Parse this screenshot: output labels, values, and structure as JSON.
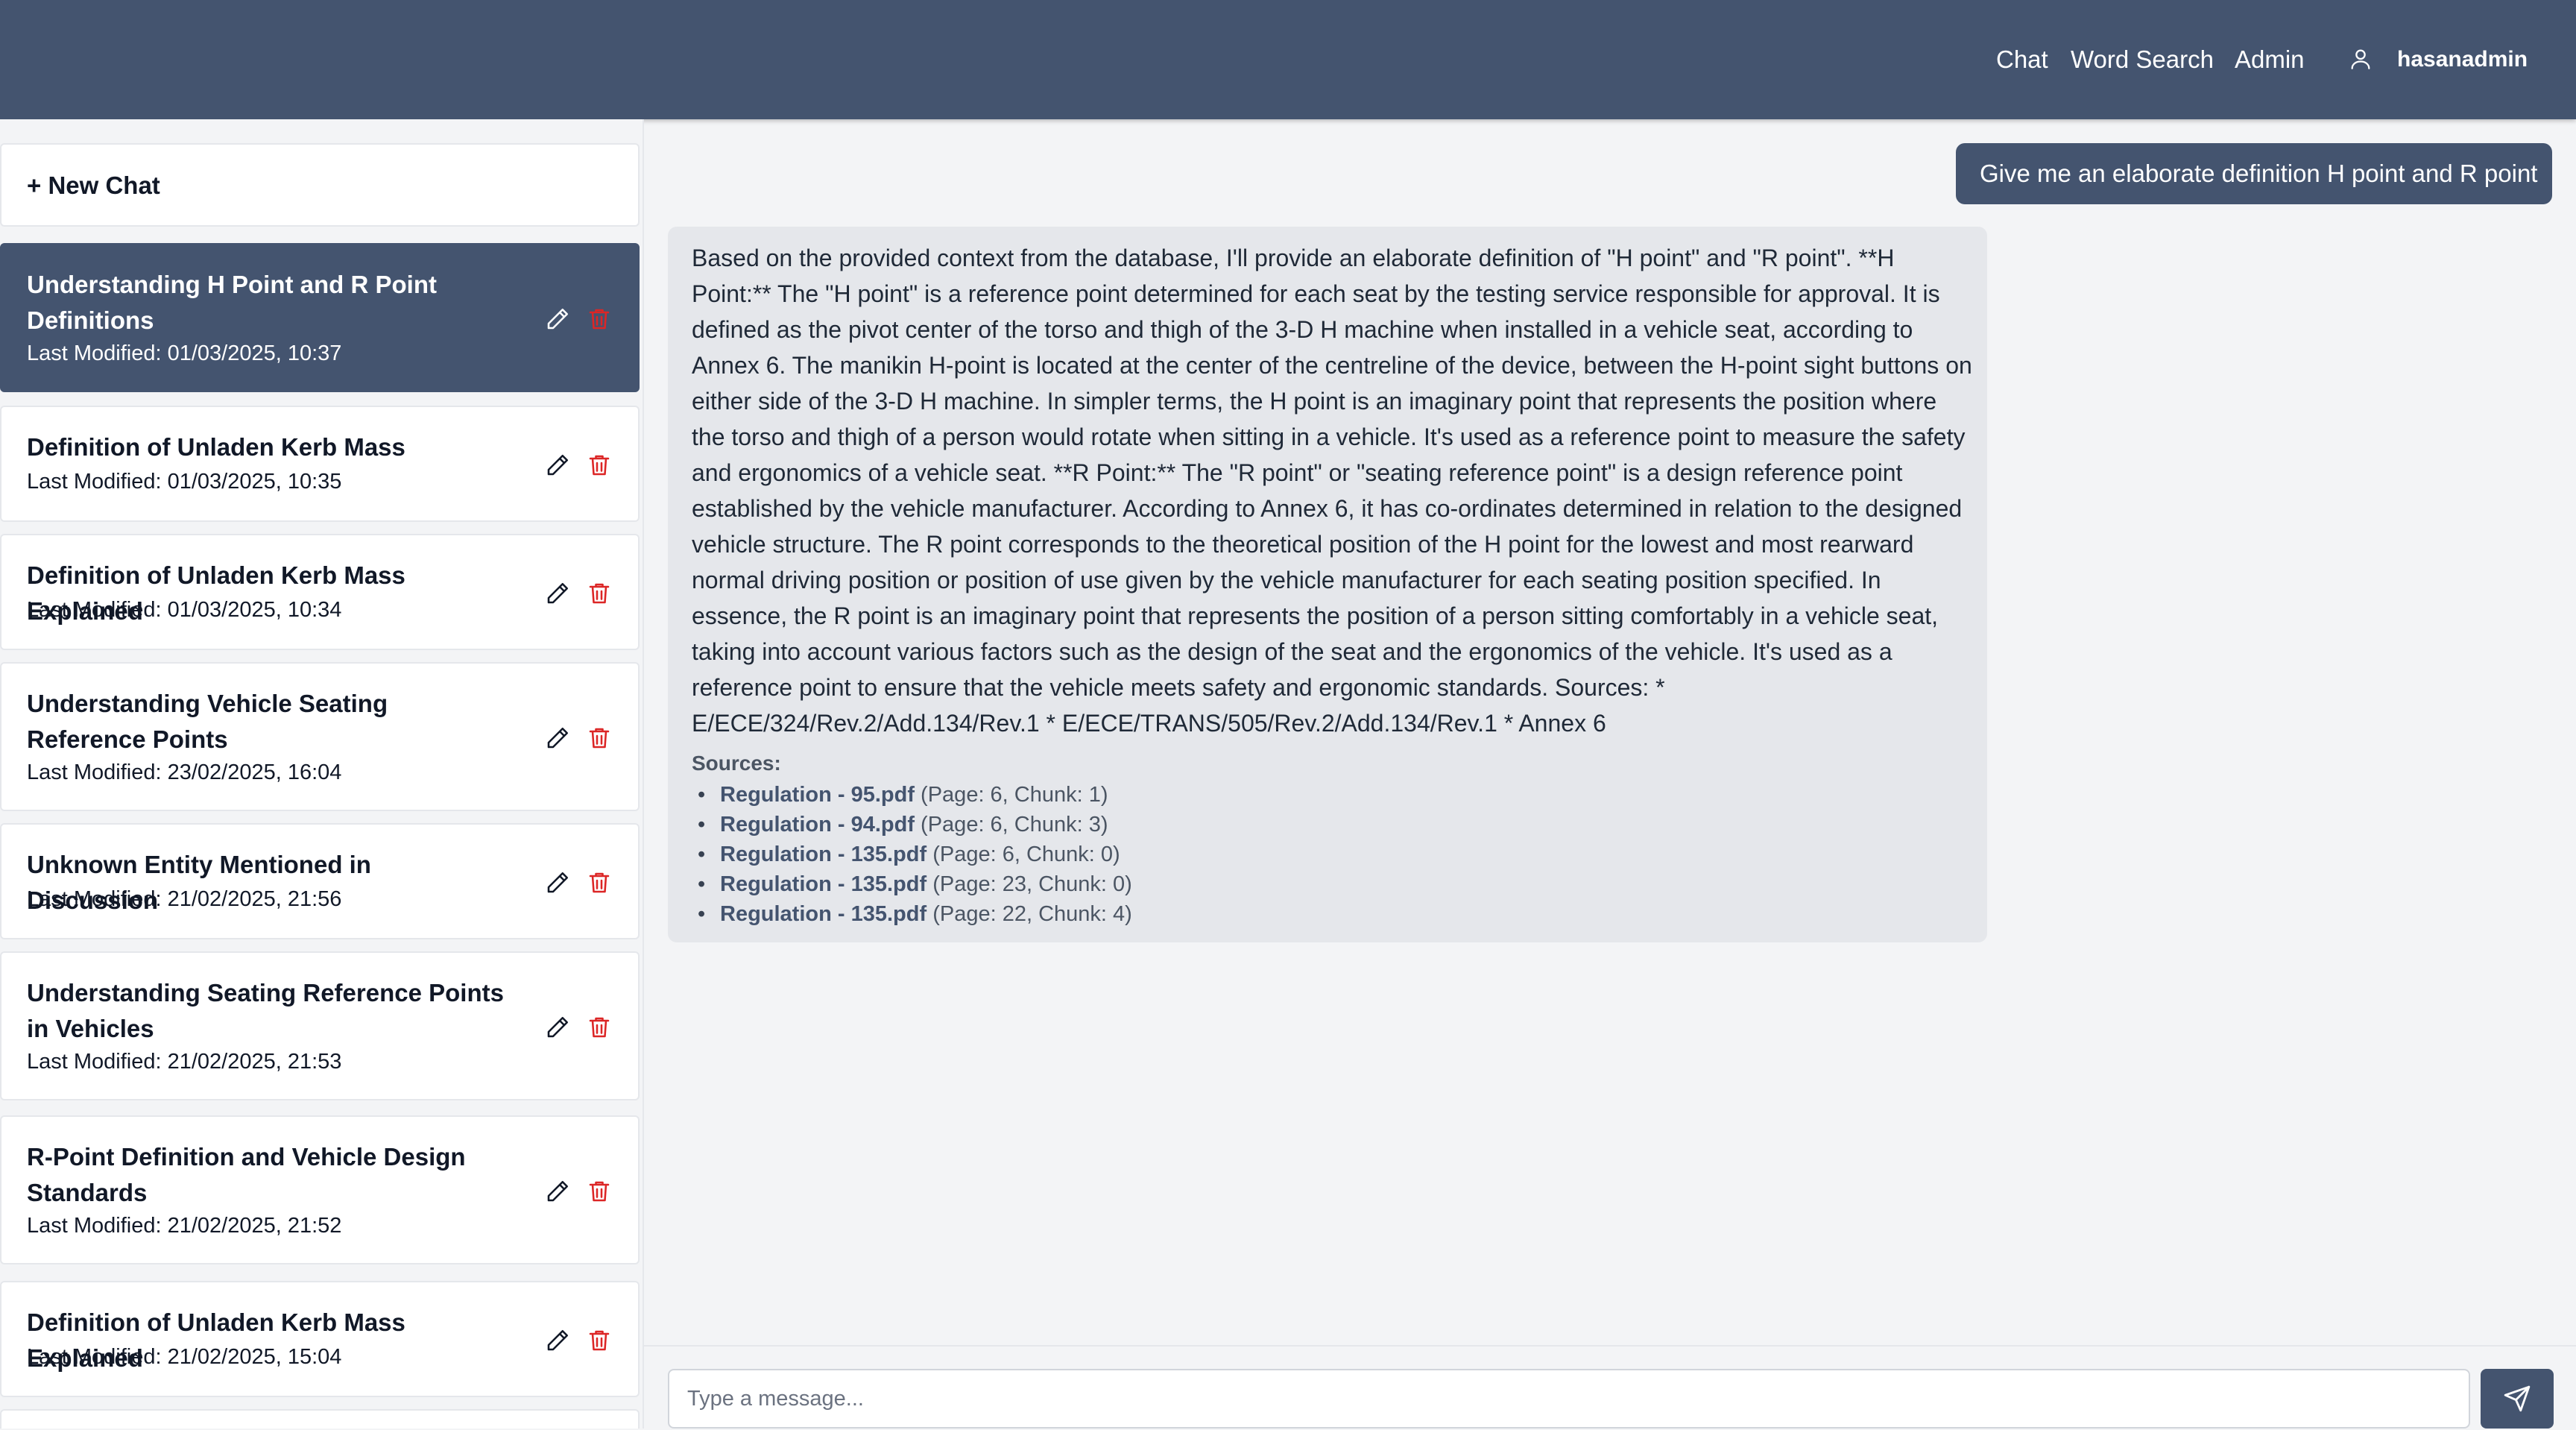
{
  "header": {
    "nav": [
      {
        "label": "Chat"
      },
      {
        "label": "Word Search"
      },
      {
        "label": "Admin"
      }
    ],
    "username": "hasanadmin",
    "user_icon": "user-icon"
  },
  "sidebar": {
    "new_chat_label": "+ New Chat",
    "chats": [
      {
        "title": "Understanding H Point and R Point Definitions",
        "meta": "Last Modified: 01/03/2025, 10:37",
        "active": true
      },
      {
        "title": "Definition of Unladen Kerb Mass",
        "meta": "Last Modified: 01/03/2025, 10:35"
      },
      {
        "title": "Definition of Unladen Kerb Mass Explained",
        "meta": "Last Modified: 01/03/2025, 10:34"
      },
      {
        "title": "Understanding Vehicle Seating Reference Points",
        "meta": "Last Modified: 23/02/2025, 16:04"
      },
      {
        "title": "Unknown Entity Mentioned in Discussion",
        "meta": "Last Modified: 21/02/2025, 21:56"
      },
      {
        "title": "Understanding Seating Reference Points in Vehicles",
        "meta": "Last Modified: 21/02/2025, 21:53"
      },
      {
        "title": "R-Point Definition and Vehicle Design Standards",
        "meta": "Last Modified: 21/02/2025, 21:52"
      },
      {
        "title": "Definition of Unladen Kerb Mass Explained",
        "meta": "Last Modified: 21/02/2025, 15:04"
      }
    ],
    "icons": {
      "edit": "pencil-icon",
      "delete": "trash-icon"
    }
  },
  "conversation": {
    "user_message": "Give me an elaborate definition H point and R point",
    "assistant_message": "Based on the provided context from the database, I'll provide an elaborate definition of \"H point\" and \"R point\". **H Point:** The \"H point\" is a reference point determined for each seat by the testing service responsible for approval. It is defined as the pivot center of the torso and thigh of the 3-D H machine when installed in a vehicle seat, according to Annex 6. The manikin H-point is located at the center of the centreline of the device, between the H-point sight buttons on either side of the 3-D H machine. In simpler terms, the H point is an imaginary point that represents the position where the torso and thigh of a person would rotate when sitting in a vehicle. It's used as a reference point to measure the safety and ergonomics of a vehicle seat. **R Point:** The \"R point\" or \"seating reference point\" is a design reference point established by the vehicle manufacturer. According to Annex 6, it has co-ordinates determined in relation to the designed vehicle structure. The R point corresponds to the theoretical position of the H point for the lowest and most rearward normal driving position or position of use given by the vehicle manufacturer for each seating position specified. In essence, the R point is an imaginary point that represents the position of a person sitting comfortably in a vehicle seat, taking into account various factors such as the design of the seat and the ergonomics of the vehicle. It's used as a reference point to ensure that the vehicle meets safety and ergonomic standards. Sources: * E/ECE/324/Rev.2/Add.134/Rev.1 * E/ECE/TRANS/505/Rev.2/Add.134/Rev.1 * Annex 6",
    "sources_label": "Sources:",
    "sources": [
      {
        "file": "Regulation - 95.pdf",
        "detail": " (Page: 6, Chunk: 1)"
      },
      {
        "file": "Regulation - 94.pdf",
        "detail": " (Page: 6, Chunk: 3)"
      },
      {
        "file": "Regulation - 135.pdf",
        "detail": " (Page: 6, Chunk: 0)"
      },
      {
        "file": "Regulation - 135.pdf",
        "detail": " (Page: 23, Chunk: 0)"
      },
      {
        "file": "Regulation - 135.pdf",
        "detail": " (Page: 22, Chunk: 4)"
      }
    ]
  },
  "input": {
    "placeholder": "Type a message...",
    "value": "",
    "send_icon": "send-icon"
  },
  "colors": {
    "primary": "#44546f",
    "delete": "#dc2626",
    "background": "#f3f4f6",
    "assistant_bubble": "#e5e7eb"
  }
}
